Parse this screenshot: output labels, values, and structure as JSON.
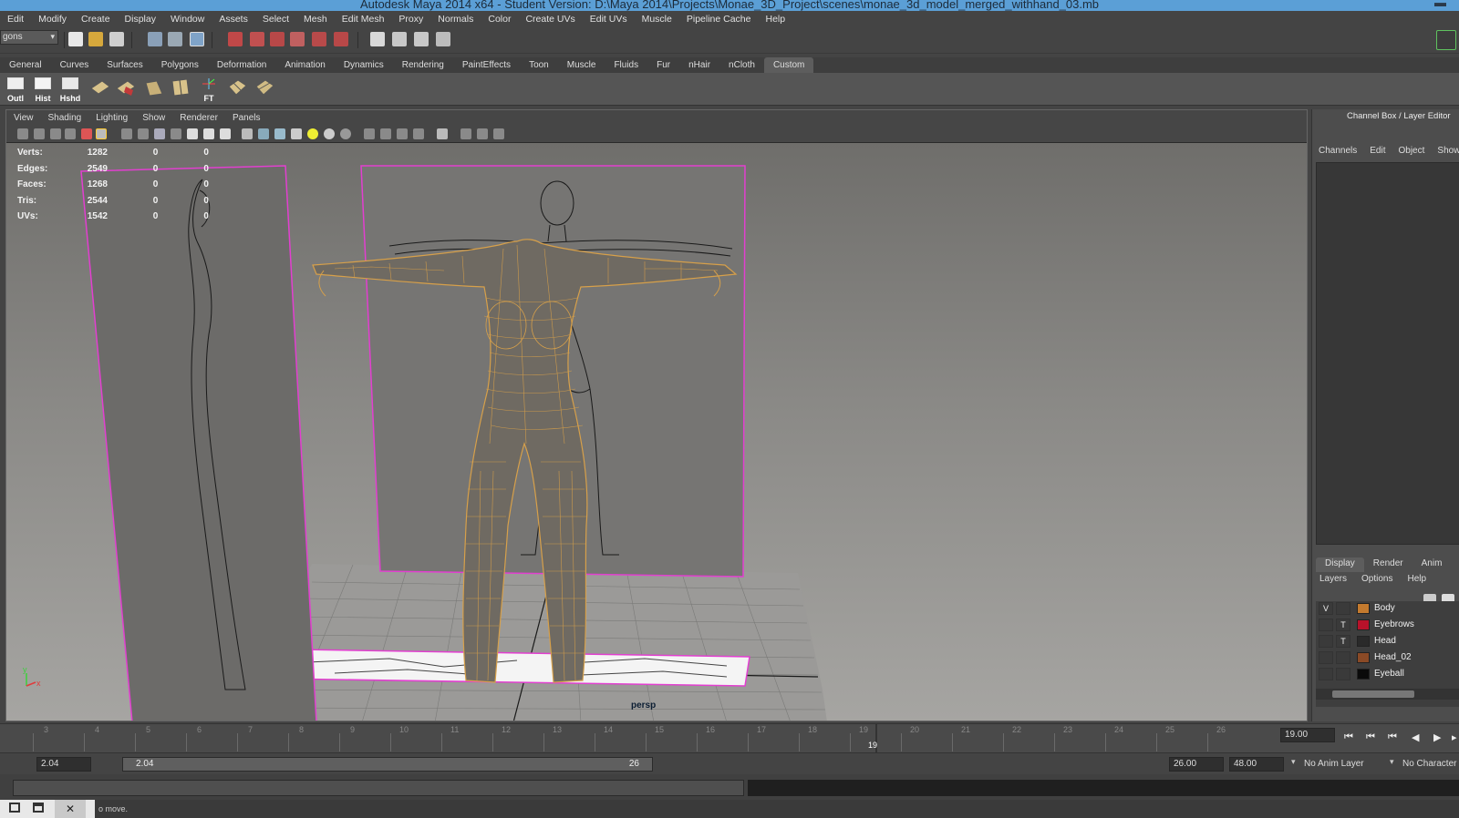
{
  "window": {
    "title": "Autodesk Maya 2014 x64 - Student Version: D:\\Maya 2014\\Projects\\Monae_3D_Project\\scenes\\monae_3d_model_merged_withhand_03.mb"
  },
  "menubar": [
    "Edit",
    "Modify",
    "Create",
    "Display",
    "Window",
    "Assets",
    "Select",
    "Mesh",
    "Edit Mesh",
    "Proxy",
    "Normals",
    "Color",
    "Create UVs",
    "Edit UVs",
    "Muscle",
    "Pipeline Cache",
    "Help"
  ],
  "status_line": {
    "mode_selector": "gons"
  },
  "shelf": {
    "tabs": [
      "General",
      "Curves",
      "Surfaces",
      "Polygons",
      "Deformation",
      "Animation",
      "Dynamics",
      "Rendering",
      "PaintEffects",
      "Toon",
      "Muscle",
      "Fluids",
      "Fur",
      "nHair",
      "nCloth",
      "Custom"
    ],
    "active_tab": "Custom",
    "buttons": [
      {
        "label": "Outl",
        "icon": "outliner-icon"
      },
      {
        "label": "Hist",
        "icon": "history-icon"
      },
      {
        "label": "Hshd",
        "icon": "hypershade-icon"
      },
      {
        "label": "",
        "icon": "poly-cube-icon"
      },
      {
        "label": "",
        "icon": "poly-extrude-icon"
      },
      {
        "label": "",
        "icon": "poly-plane-icon"
      },
      {
        "label": "",
        "icon": "poly-split-icon"
      },
      {
        "label": "FT",
        "icon": "freeze-transform-icon"
      },
      {
        "label": "",
        "icon": "poly-smooth-icon"
      },
      {
        "label": "",
        "icon": "poly-merge-icon"
      }
    ]
  },
  "viewport": {
    "menu": [
      "View",
      "Shading",
      "Lighting",
      "Show",
      "Renderer",
      "Panels"
    ],
    "camera_label": "persp",
    "hud": [
      {
        "key": "Verts:",
        "value": "1282",
        "c2": "0",
        "c3": "0"
      },
      {
        "key": "Edges:",
        "value": "2549",
        "c2": "0",
        "c3": "0"
      },
      {
        "key": "Faces:",
        "value": "1268",
        "c2": "0",
        "c3": "0"
      },
      {
        "key": "Tris:",
        "value": "2544",
        "c2": "0",
        "c3": "0"
      },
      {
        "key": "UVs:",
        "value": "1542",
        "c2": "0",
        "c3": "0"
      }
    ],
    "axis": {
      "x": "x",
      "y": "y"
    }
  },
  "timeline": {
    "ticks": [
      "3",
      "4",
      "5",
      "6",
      "7",
      "8",
      "9",
      "10",
      "11",
      "12",
      "13",
      "14",
      "15",
      "16",
      "17",
      "18",
      "19",
      "20",
      "21",
      "22",
      "23",
      "24",
      "25",
      "26"
    ],
    "current_frame": "19",
    "current_time_field": "19.00"
  },
  "range_slider": {
    "start_time": "2.04",
    "range_start": "2.04",
    "range_end": "26",
    "end_time": "26.00",
    "max_time": "48.00",
    "anim_layer": "No Anim Layer",
    "character": "No Character"
  },
  "help_line": {
    "text": "o move."
  },
  "channel_box": {
    "title": "Channel Box / Layer Editor",
    "menu": [
      "Channels",
      "Edit",
      "Object",
      "Show"
    ]
  },
  "layer_editor": {
    "tabs": [
      "Display",
      "Render",
      "Anim"
    ],
    "active_tab": "Display",
    "menu": [
      "Layers",
      "Options",
      "Help"
    ],
    "layers": [
      {
        "visible": "V",
        "type": "",
        "name": "Body",
        "color": "#c37a2e"
      },
      {
        "visible": "",
        "type": "T",
        "name": "Eyebrows",
        "color": "#b8122a"
      },
      {
        "visible": "",
        "type": "T",
        "name": "Head",
        "color": "#2a2a2a"
      },
      {
        "visible": "",
        "type": "",
        "name": "Head_02",
        "color": "#8a4a26"
      },
      {
        "visible": "",
        "type": "",
        "name": "Eyeball",
        "color": "#0a0a0a"
      }
    ]
  },
  "colors": {
    "title_bar": "#5b9fd6",
    "selection_highlight": "#e23fd0",
    "wireframe": "#d7a04a",
    "camera_label": "#0c1e33"
  }
}
